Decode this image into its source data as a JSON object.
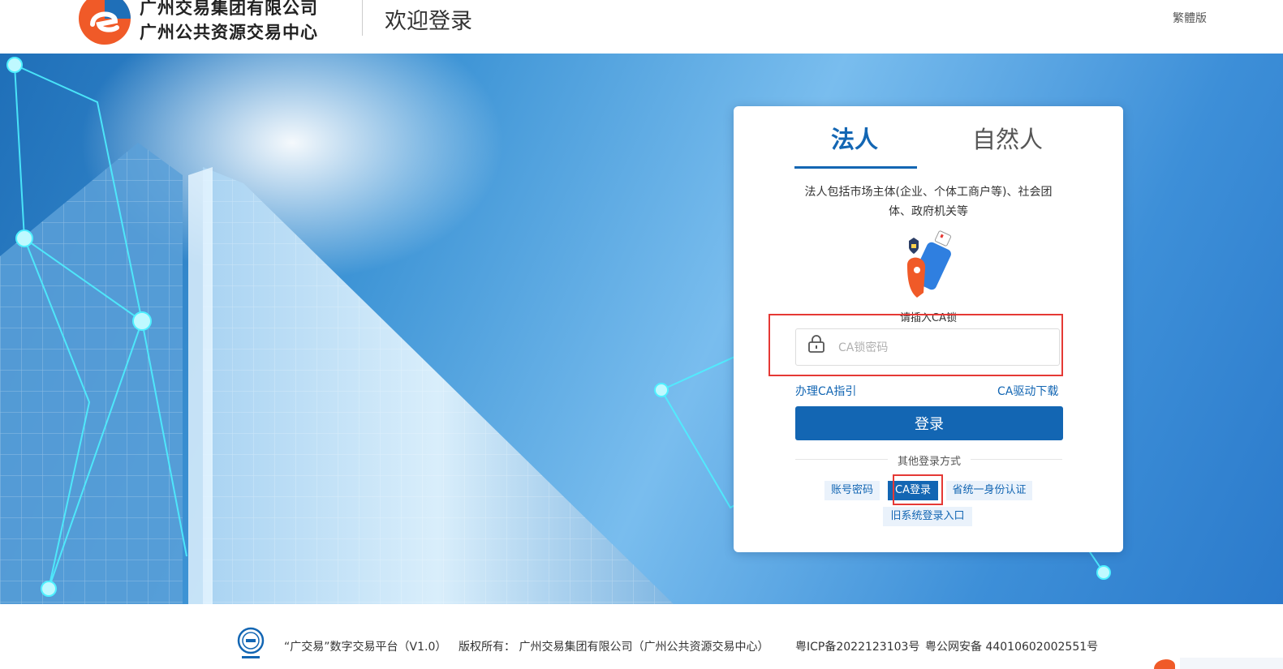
{
  "header": {
    "org_name_line1": "广州交易集团有限公司",
    "org_name_line2": "广州公共资源交易中心",
    "welcome": "欢迎登录",
    "lang_switch": "繁體版"
  },
  "login": {
    "tabs": [
      {
        "label": "法人",
        "active": true
      },
      {
        "label": "自然人",
        "active": false
      }
    ],
    "description": "法人包括市场主体(企业、个体工商户等)、社会团体、政府机关等",
    "ca_hint": "请插入CA锁",
    "password_placeholder": "CA锁密码",
    "password_value": "",
    "link_guide": "办理CA指引",
    "link_driver": "CA驱动下载",
    "login_button": "登录",
    "other_methods_title": "其他登录方式",
    "methods": {
      "account": "账号密码",
      "ca": "CA登录",
      "gov": "省统一身份认证",
      "old_system": "旧系统登录入口"
    },
    "selected_method": "CA登录"
  },
  "footer": {
    "platform": "“广交易”数字交易平台（V1.0）",
    "copyright": "版权所有：  广州交易集团有限公司（广州公共资源交易中心）",
    "icp": "粤ICP备2022123103号",
    "police": "粤公网安备 44010602002551号"
  },
  "colors": {
    "primary": "#1366b3",
    "highlight_box": "#e53935",
    "logo_orange": "#f05a28",
    "logo_blue": "#1f6fb8"
  },
  "icons": [
    "logo-icon",
    "ca-usb-key-icon",
    "lock-icon",
    "ebs-badge-icon"
  ]
}
